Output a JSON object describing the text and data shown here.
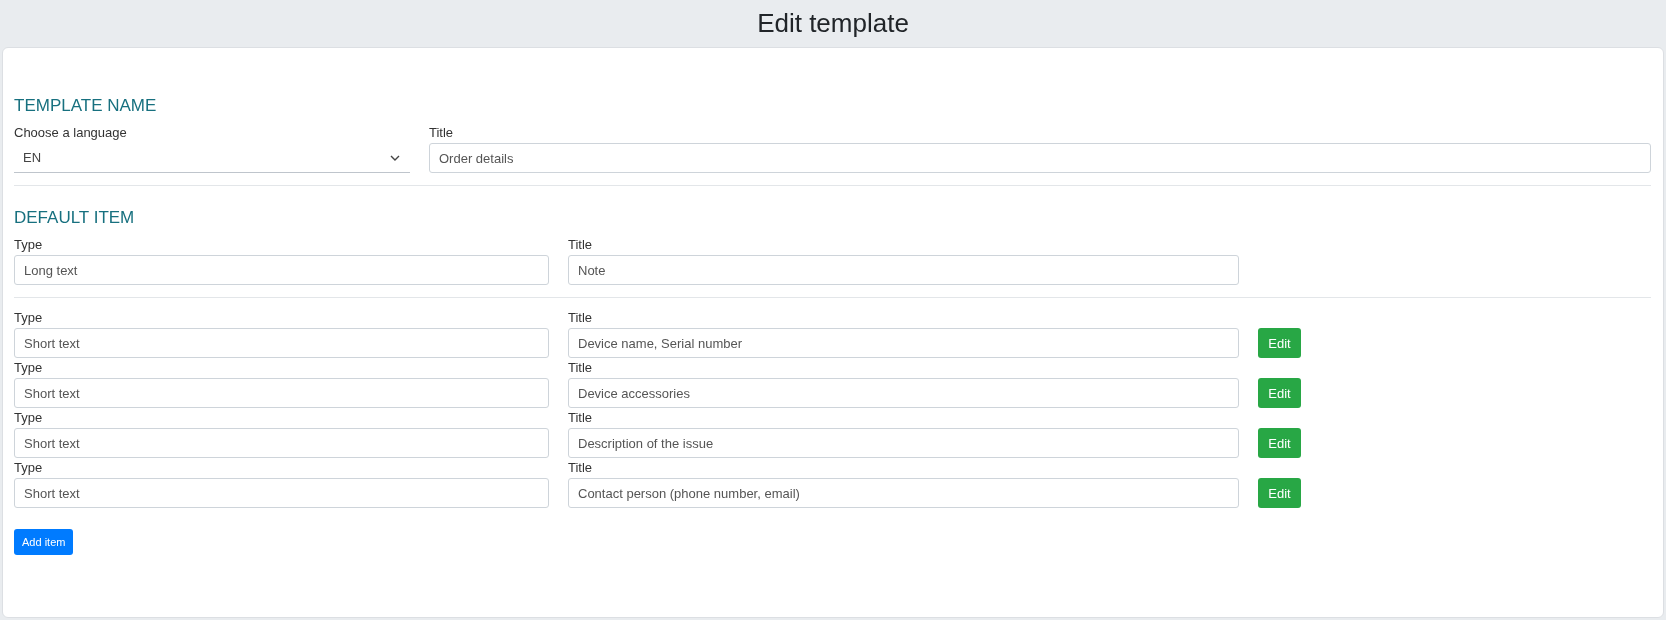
{
  "header": {
    "title": "Edit template"
  },
  "template_name": {
    "heading": "TEMPLATE NAME",
    "language": {
      "label": "Choose a language",
      "value": "EN"
    },
    "title": {
      "label": "Title",
      "value": "Order details"
    }
  },
  "default_item": {
    "heading": "DEFAULT ITEM",
    "type": {
      "label": "Type",
      "value": "Long text"
    },
    "title": {
      "label": "Title",
      "value": "Note"
    }
  },
  "items": [
    {
      "type_label": "Type",
      "type_value": "Short text",
      "title_label": "Title",
      "title_value": "Device name, Serial number",
      "edit_button": "Edit"
    },
    {
      "type_label": "Type",
      "type_value": "Short text",
      "title_label": "Title",
      "title_value": "Device accessories",
      "edit_button": "Edit"
    },
    {
      "type_label": "Type",
      "type_value": "Short text",
      "title_label": "Title",
      "title_value": "Description of the issue",
      "edit_button": "Edit"
    },
    {
      "type_label": "Type",
      "type_value": "Short text",
      "title_label": "Title",
      "title_value": "Contact person (phone number, email)",
      "edit_button": "Edit"
    }
  ],
  "add_button": "Add item"
}
